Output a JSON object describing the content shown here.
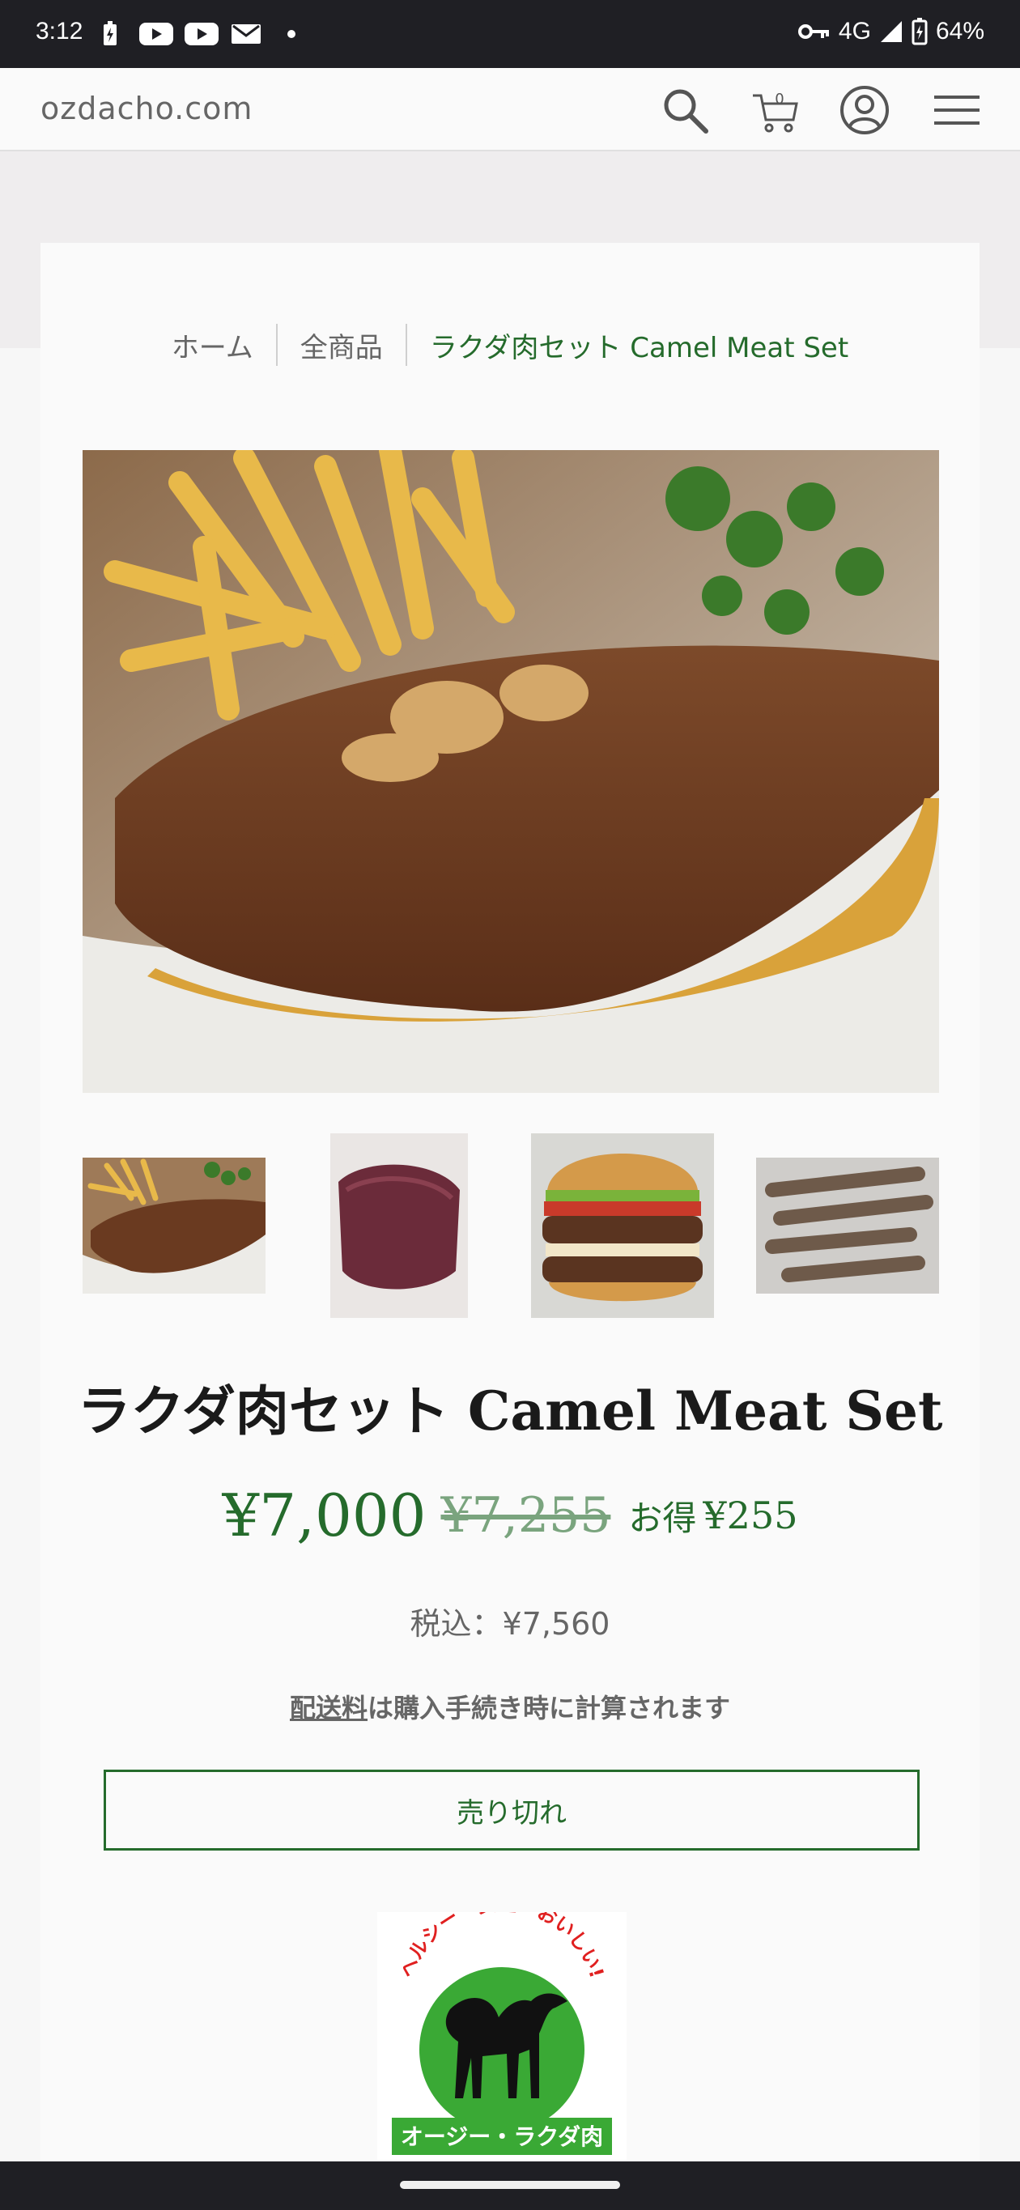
{
  "status_bar": {
    "time": "3:12",
    "network": "4G",
    "battery": "64%"
  },
  "header": {
    "site_name": "ozdacho.com",
    "cart_count": "0"
  },
  "breadcrumb": {
    "home": "ホーム",
    "all_products": "全商品",
    "current": "ラクダ肉セット Camel Meat Set"
  },
  "product": {
    "title": "ラクダ肉セット Camel Meat Set",
    "price": "¥7,000",
    "compare_price": "¥7,255",
    "save_label": "お得",
    "save_amount": "¥255",
    "tax_label": "税込：¥7,560",
    "shipping_link": "配送料",
    "shipping_text": "は購入手続き時に計算されます",
    "sold_out_label": "売り切れ"
  },
  "logo": {
    "arc_text": "ヘルシー・安全・おいしい!",
    "banner_text": "オージー・ラクダ肉"
  },
  "colors": {
    "accent": "#256b2c",
    "logo_green": "#3aa935",
    "logo_red": "#e02020"
  }
}
